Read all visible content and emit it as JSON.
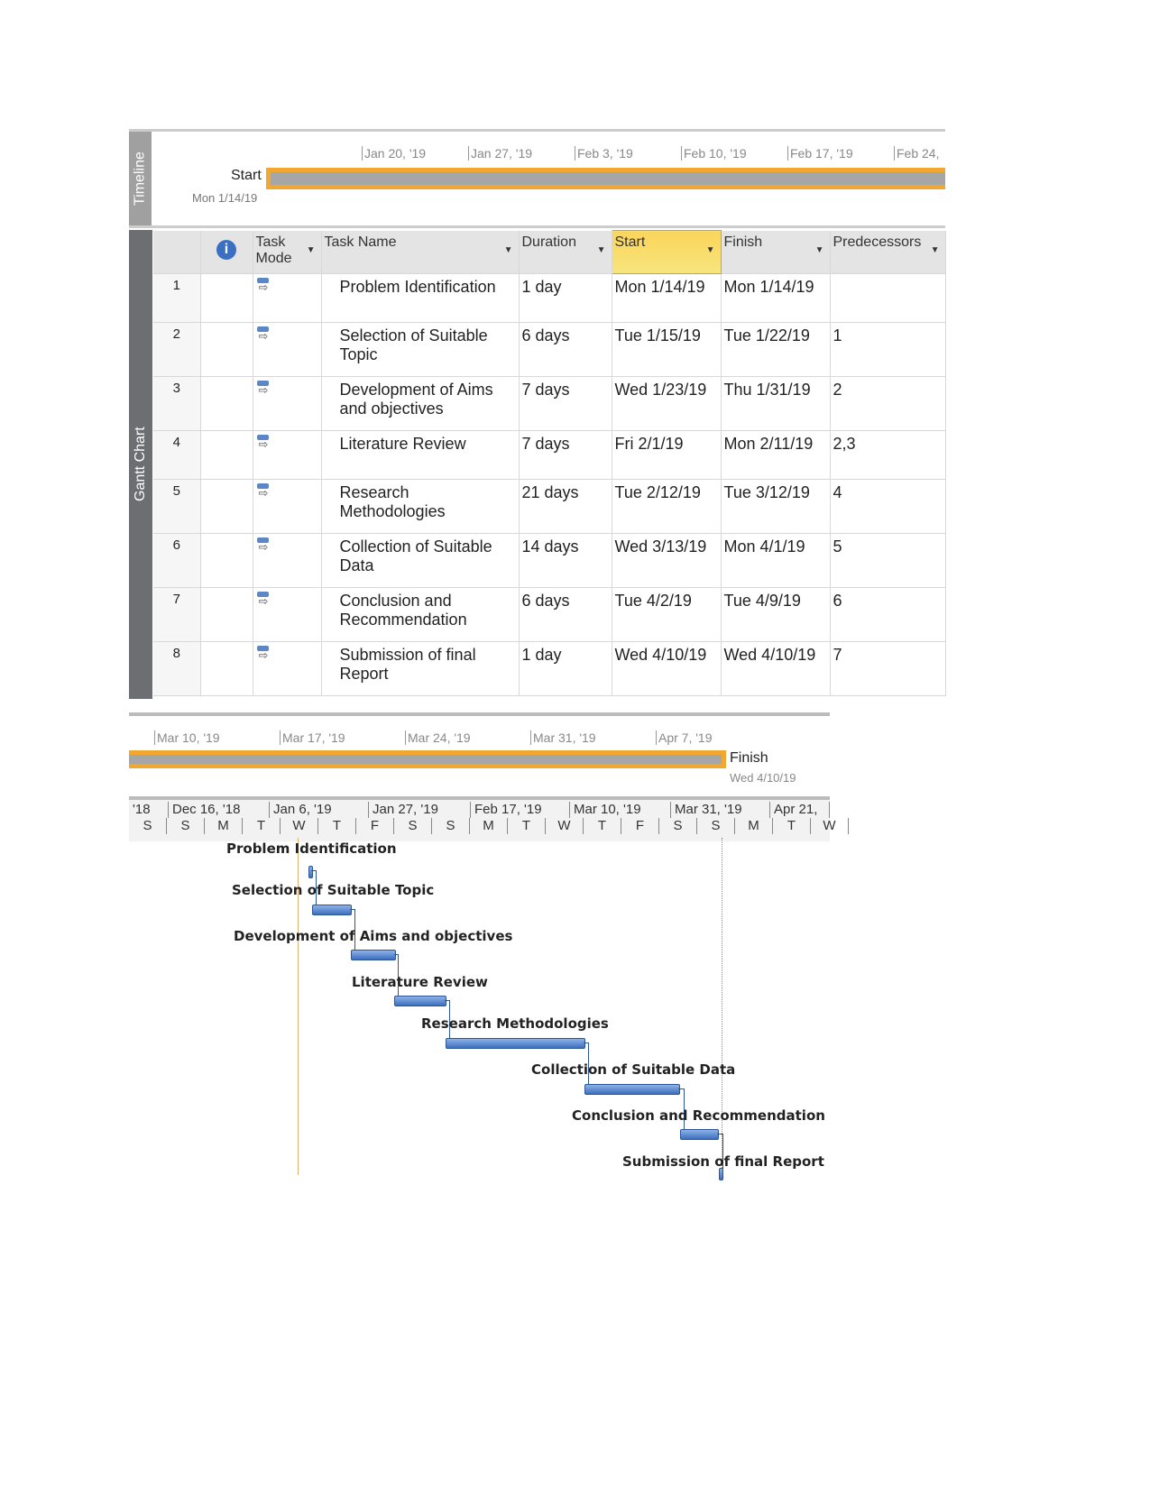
{
  "timeline": {
    "label": "Timeline",
    "start_label": "Start",
    "start_date": "Mon 1/14/19",
    "ticks": [
      "Jan 20, '19",
      "Jan 27, '19",
      "Feb 3, '19",
      "Feb 10, '19",
      "Feb 17, '19",
      "Feb 24,"
    ],
    "ticks2": [
      "Mar 10, '19",
      "Mar 17, '19",
      "Mar 24, '19",
      "Mar 31, '19",
      "Apr 7, '19"
    ],
    "finish_label": "Finish",
    "finish_date": "Wed 4/10/19",
    "bar_color": "#f0a830"
  },
  "sheet": {
    "side_label": "Gantt Chart",
    "columns": [
      "",
      "i",
      "Task Mode",
      "Task Name",
      "Duration",
      "Start",
      "Finish",
      "Predecessors"
    ],
    "selected_column": "Start",
    "rows": [
      {
        "id": "1",
        "name": "Problem Identification",
        "duration": "1 day",
        "start": "Mon 1/14/19",
        "finish": "Mon 1/14/19",
        "pred": ""
      },
      {
        "id": "2",
        "name": "Selection of Suitable Topic",
        "duration": "6 days",
        "start": "Tue 1/15/19",
        "finish": "Tue 1/22/19",
        "pred": "1"
      },
      {
        "id": "3",
        "name": "Development of Aims and objectives",
        "duration": "7 days",
        "start": "Wed 1/23/19",
        "finish": "Thu 1/31/19",
        "pred": "2"
      },
      {
        "id": "4",
        "name": "Literature Review",
        "duration": "7 days",
        "start": "Fri 2/1/19",
        "finish": "Mon 2/11/19",
        "pred": "2,3"
      },
      {
        "id": "5",
        "name": "Research Methodologies",
        "duration": "21 days",
        "start": "Tue 2/12/19",
        "finish": "Tue 3/12/19",
        "pred": "4"
      },
      {
        "id": "6",
        "name": "Collection of Suitable Data",
        "duration": "14 days",
        "start": "Wed 3/13/19",
        "finish": "Mon 4/1/19",
        "pred": "5"
      },
      {
        "id": "7",
        "name": "Conclusion and Recommendation",
        "duration": "6 days",
        "start": "Tue 4/2/19",
        "finish": "Tue 4/9/19",
        "pred": "6"
      },
      {
        "id": "8",
        "name": "Submission of final Report",
        "duration": "1 day",
        "start": "Wed 4/10/19",
        "finish": "Wed 4/10/19",
        "pred": "7"
      }
    ]
  },
  "gantt": {
    "top_scale": [
      "'18",
      "Dec 16, '18",
      "Jan 6, '19",
      "Jan 27, '19",
      "Feb 17, '19",
      "Mar 10, '19",
      "Mar 31, '19",
      "Apr 21,"
    ],
    "bottom_scale": [
      "S",
      "S",
      "M",
      "T",
      "W",
      "T",
      "F",
      "S",
      "S",
      "M",
      "T",
      "W",
      "T",
      "F",
      "S",
      "S",
      "M",
      "T",
      "W"
    ],
    "bar_color": "#4f81c7"
  }
}
